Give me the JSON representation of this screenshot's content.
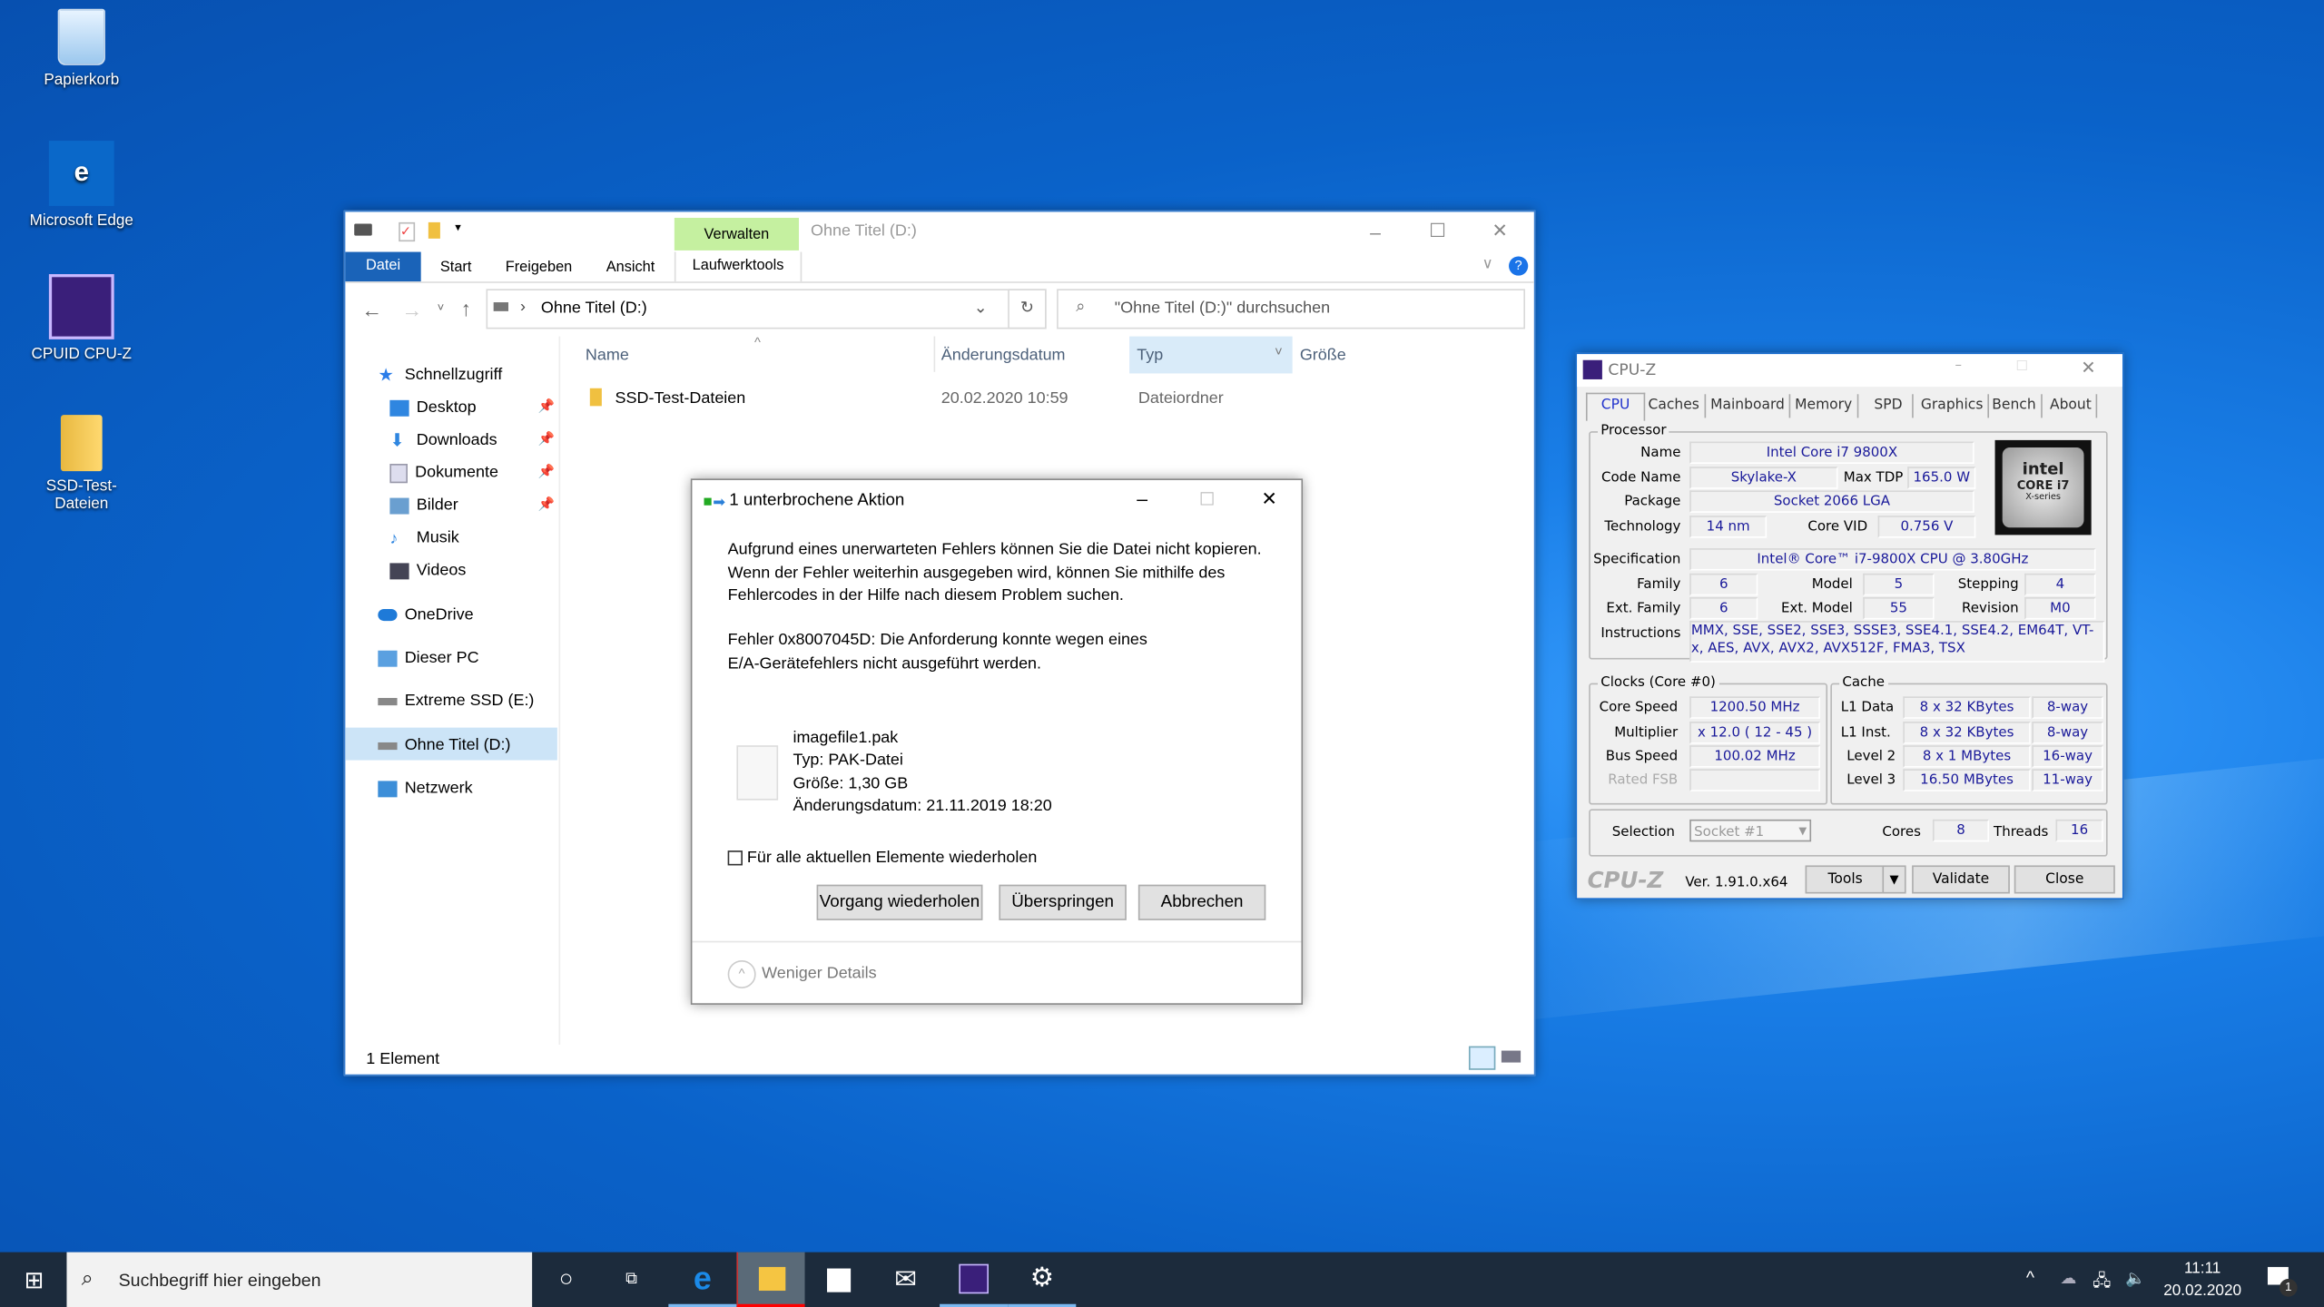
{
  "desktop": {
    "icons": [
      {
        "label": "Papierkorb"
      },
      {
        "label": "Microsoft Edge"
      },
      {
        "label": "CPUID CPU-Z"
      },
      {
        "label": "SSD-Test-Dateien"
      }
    ]
  },
  "explorer": {
    "title": "Ohne Titel (D:)",
    "context_tab": "Verwalten",
    "ribbon_tabs": [
      "Datei",
      "Start",
      "Freigeben",
      "Ansicht",
      "Laufwerktools"
    ],
    "address": "Ohne Titel (D:)",
    "search_placeholder": "\"Ohne Titel (D:)\" durchsuchen",
    "columns": [
      "Name",
      "Änderungsdatum",
      "Typ",
      "Größe"
    ],
    "rows": [
      {
        "name": "SSD-Test-Dateien",
        "date": "20.02.2020 10:59",
        "type": "Dateiordner",
        "size": ""
      }
    ],
    "nav": [
      {
        "label": "Schnellzugriff"
      },
      {
        "label": "Desktop"
      },
      {
        "label": "Downloads"
      },
      {
        "label": "Dokumente"
      },
      {
        "label": "Bilder"
      },
      {
        "label": "Musik"
      },
      {
        "label": "Videos"
      },
      {
        "label": "OneDrive"
      },
      {
        "label": "Dieser PC"
      },
      {
        "label": "Extreme SSD (E:)"
      },
      {
        "label": "Ohne Titel (D:)"
      },
      {
        "label": "Netzwerk"
      }
    ],
    "status": "1 Element"
  },
  "dialog": {
    "title": "1 unterbrochene Aktion",
    "message": [
      "Aufgrund eines unerwarteten Fehlers können Sie die Datei nicht kopieren.",
      "Wenn der Fehler weiterhin ausgegeben wird, können Sie mithilfe des",
      "Fehlercodes in der Hilfe nach diesem Problem suchen."
    ],
    "error": [
      "Fehler 0x8007045D: Die Anforderung konnte wegen eines",
      "E/A-Gerätefehlers nicht ausgeführt werden."
    ],
    "file": {
      "name": "imagefile1.pak",
      "type": "Typ: PAK-Datei",
      "size": "Größe: 1,30 GB",
      "modified": "Änderungsdatum: 21.11.2019 18:20"
    },
    "checkbox": "Für alle aktuellen Elemente wiederholen",
    "buttons": {
      "retry": "Vorgang wiederholen",
      "skip": "Überspringen",
      "cancel": "Abbrechen"
    },
    "details": "Weniger Details"
  },
  "cpuz": {
    "title": "CPU-Z",
    "tabs": [
      "CPU",
      "Caches",
      "Mainboard",
      "Memory",
      "SPD",
      "Graphics",
      "Bench",
      "About"
    ],
    "processor_label": "Processor",
    "labels": {
      "name": "Name",
      "codename": "Code Name",
      "maxtdp": "Max TDP",
      "package": "Package",
      "technology": "Technology",
      "corevid": "Core VID",
      "spec": "Specification",
      "family": "Family",
      "model": "Model",
      "stepping": "Stepping",
      "extfamily": "Ext. Family",
      "extmodel": "Ext. Model",
      "revision": "Revision",
      "instructions": "Instructions"
    },
    "values": {
      "name": "Intel Core i7 9800X",
      "codename": "Skylake-X",
      "maxtdp": "165.0 W",
      "package": "Socket 2066 LGA",
      "technology": "14 nm",
      "corevid": "0.756 V",
      "spec": "Intel® Core™ i7-9800X CPU @ 3.80GHz",
      "family": "6",
      "model": "5",
      "stepping": "4",
      "extfamily": "6",
      "extmodel": "55",
      "revision": "M0",
      "instructions": "MMX, SSE, SSE2, SSE3, SSSE3, SSE4.1, SSE4.2, EM64T, VT-x, AES, AVX, AVX2, AVX512F, FMA3, TSX"
    },
    "logo": {
      "brand": "intel",
      "line1": "CORE i7",
      "line2": "X-series"
    },
    "clocks": {
      "title": "Clocks (Core #0)",
      "rows": [
        {
          "label": "Core Speed",
          "value": "1200.50 MHz"
        },
        {
          "label": "Multiplier",
          "value": "x 12.0 ( 12 - 45 )"
        },
        {
          "label": "Bus Speed",
          "value": "100.02 MHz"
        },
        {
          "label": "Rated FSB",
          "value": ""
        }
      ]
    },
    "cache": {
      "title": "Cache",
      "rows": [
        {
          "label": "L1 Data",
          "size": "8 x 32 KBytes",
          "way": "8-way"
        },
        {
          "label": "L1 Inst.",
          "size": "8 x 32 KBytes",
          "way": "8-way"
        },
        {
          "label": "Level 2",
          "size": "8 x 1 MBytes",
          "way": "16-way"
        },
        {
          "label": "Level 3",
          "size": "16.50 MBytes",
          "way": "11-way"
        }
      ]
    },
    "selection_label": "Selection",
    "selection": "Socket #1",
    "cores_label": "Cores",
    "cores": "8",
    "threads_label": "Threads",
    "threads": "16",
    "brand": "CPU-Z",
    "version": "Ver. 1.91.0.x64",
    "buttons": {
      "tools": "Tools",
      "validate": "Validate",
      "close": "Close"
    }
  },
  "taskbar": {
    "search_placeholder": "Suchbegriff hier eingeben",
    "time": "11:11",
    "date": "20.02.2020",
    "notifications": "1"
  },
  "colors": {
    "accent": "#0063b1",
    "verwalten": "#c5f0a0",
    "cpuz_value": "#1a1a9a"
  }
}
